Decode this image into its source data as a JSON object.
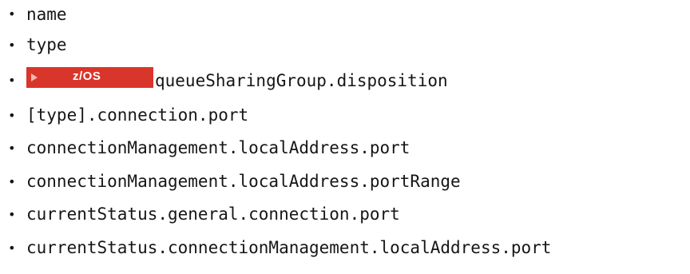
{
  "list": {
    "items": [
      {
        "text": "name"
      },
      {
        "text": "type"
      },
      {
        "badge": "z/OS",
        "text": "queueSharingGroup.disposition"
      },
      {
        "text": "[type].connection.port"
      },
      {
        "text": "connectionManagement.localAddress.port"
      },
      {
        "text": "connectionManagement.localAddress.portRange"
      },
      {
        "text": "currentStatus.general.connection.port"
      },
      {
        "text": "currentStatus.connectionManagement.localAddress.port"
      }
    ]
  },
  "colors": {
    "badge_background": "#d9362b",
    "badge_text": "#ffffff",
    "text": "#161616"
  },
  "icons": {
    "bullet": "bullet-dot-icon",
    "badge_marker": "triangle-right-icon"
  }
}
